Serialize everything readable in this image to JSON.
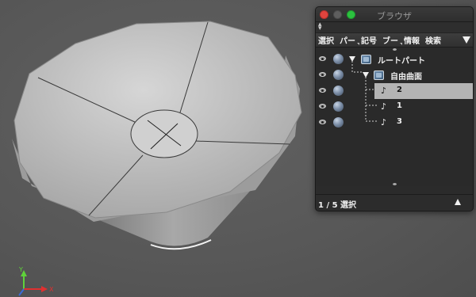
{
  "browser": {
    "title": "ブラウザ",
    "menu": [
      "選択",
      "パー",
      "記号",
      "ブー",
      "情報",
      "検索"
    ],
    "tree": [
      {
        "label": "ルートパート",
        "level": 0,
        "expanded": true,
        "type": "part"
      },
      {
        "label": "自由曲面",
        "level": 1,
        "expanded": true,
        "type": "part"
      },
      {
        "label": "2",
        "level": 2,
        "type": "curve",
        "selected": true
      },
      {
        "label": "1",
        "level": 2,
        "type": "curve"
      },
      {
        "label": "3",
        "level": 2,
        "type": "curve"
      }
    ],
    "status": "1 / 5 選択"
  },
  "viewport": {
    "axis": {
      "y_label": "Y",
      "x_label": "X"
    },
    "colors": {
      "background": "#5b5b5b",
      "surface": "#b8b8b8",
      "y_axis": "#5fd23a",
      "x_axis": "#e03030",
      "z_axis": "#3a6ad6"
    }
  }
}
